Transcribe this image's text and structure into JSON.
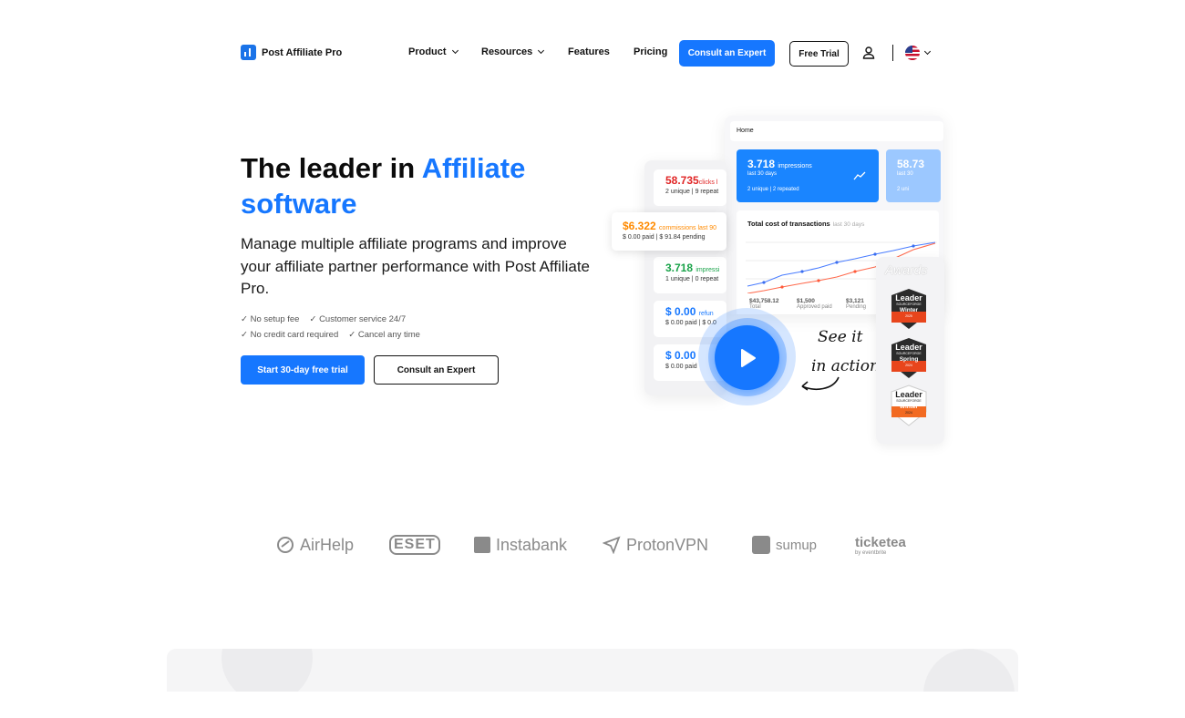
{
  "header": {
    "logo_text": "Post Affiliate Pro",
    "nav": [
      {
        "label": "Product",
        "dropdown": true
      },
      {
        "label": "Resources",
        "dropdown": true
      },
      {
        "label": "Features",
        "dropdown": false
      },
      {
        "label": "Pricing",
        "dropdown": false
      }
    ],
    "consult_label": "Consult an Expert",
    "free_trial_label": "Free Trial",
    "icons": [
      "user-icon",
      "us-flag-icon"
    ]
  },
  "hero": {
    "title_part1": "The leader in ",
    "title_highlight": "Affiliate",
    "title_part2": "software",
    "lead": "Manage multiple affiliate programs and improve your affiliate partner performance with Post Affiliate Pro.",
    "checks_row1": [
      "✓ No setup fee",
      "✓ Customer service 24/7"
    ],
    "checks_row2": [
      "✓ No credit card required",
      "✓ Cancel any time"
    ],
    "cta_primary": "Start 30-day free trial",
    "cta_secondary": "Consult an Expert"
  },
  "dashboard": {
    "home_label": "Home",
    "tile1": {
      "value": "3.718",
      "unit": "impressions",
      "period": "last 30 days",
      "sub": "2 unique | 2 repeated"
    },
    "tile2": {
      "value": "58.73",
      "period": "last 30",
      "sub": "2 uni"
    },
    "chart_title": "Total cost of transactions",
    "chart_period": "last 30 days",
    "mini_stats": [
      {
        "value": "$43,758.12",
        "label": "Total"
      },
      {
        "value": "$1,500",
        "label": "Approved paid"
      },
      {
        "value": "$3,121",
        "label": "Pending"
      }
    ],
    "stats": [
      {
        "value": "58.735",
        "unit": "clicks l",
        "sub": "2 unique | 9 repeat",
        "color": "#e02424"
      },
      {
        "value": "3.718",
        "unit": "impressi",
        "sub": "1 unique | 0 repeat",
        "color": "#1aa34a"
      },
      {
        "value": "$ 0.00",
        "unit": "refun",
        "sub": "$ 0.00 paid | $ 0.0",
        "color": "#1677ff"
      },
      {
        "value": "$ 0.00",
        "unit": "",
        "sub": "$ 0.00 paid",
        "color": "#1677ff"
      }
    ],
    "float_card": {
      "value": "$6.322",
      "unit": "commissions last 90",
      "sub": "$ 0.00 paid | $ 91.84 pending"
    },
    "see_it": "See it",
    "in_action": "in action",
    "awards_title": "Awards",
    "badges": [
      {
        "title": "Leader",
        "brand": "SOURCEFORGE",
        "season": "Winter",
        "year": "2025",
        "color": "#e8451c"
      },
      {
        "title": "Leader",
        "brand": "SOURCEFORGE",
        "season": "Spring",
        "year": "2024",
        "color": "#e8451c"
      },
      {
        "title": "Leader",
        "brand": "SOURCEFORGE",
        "season": "Winter",
        "year": "2024",
        "color": "#f26a21"
      }
    ]
  },
  "logos": [
    "AirHelp",
    "ESET",
    "Instabank",
    "ProtonVPN",
    "sumup",
    "ticketea"
  ],
  "logos_sub": "by eventbrite"
}
